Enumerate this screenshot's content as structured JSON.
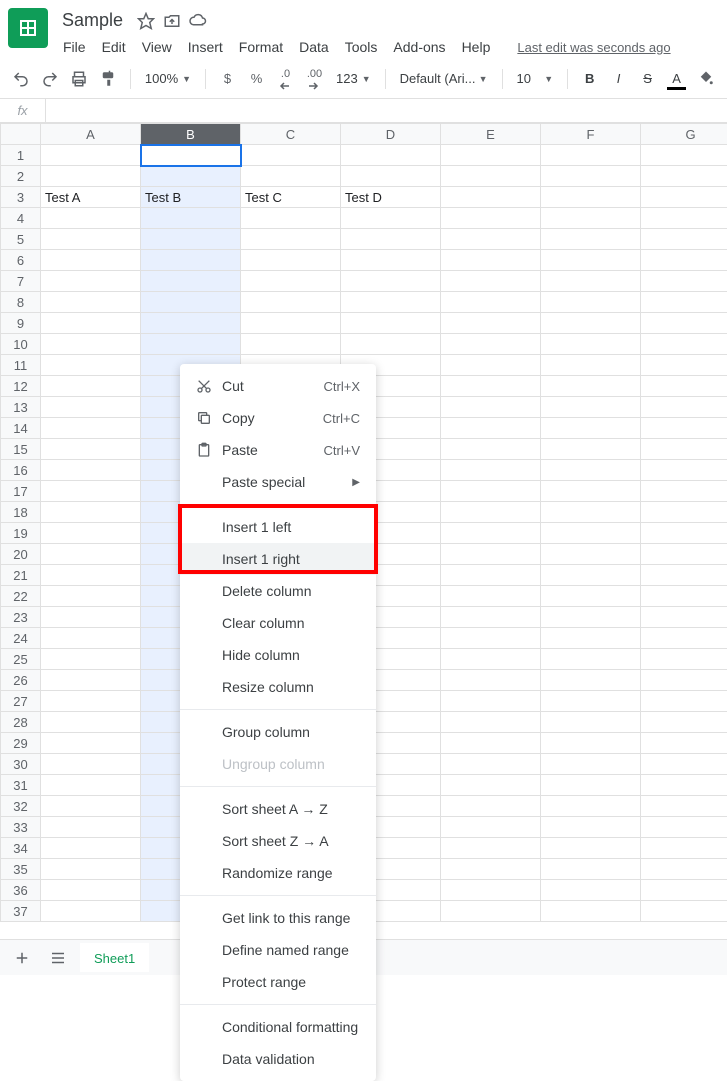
{
  "doc": {
    "title": "Sample",
    "last_edit": "Last edit was seconds ago"
  },
  "menubar": [
    "File",
    "Edit",
    "View",
    "Insert",
    "Format",
    "Data",
    "Tools",
    "Add-ons",
    "Help"
  ],
  "toolbar": {
    "zoom": "100%",
    "currency": "$",
    "percent": "%",
    "dec_dec": ".0",
    "dec_inc": ".00",
    "numfmt": "123",
    "font": "Default (Ari...",
    "font_size": "10",
    "bold": "B",
    "italic": "I",
    "strike": "S",
    "textcolor": "A"
  },
  "columns": [
    "A",
    "B",
    "C",
    "D",
    "E",
    "F",
    "G"
  ],
  "selected_column_index": 1,
  "row_count": 37,
  "cells": {
    "3": {
      "A": "Test A",
      "B": "Test B",
      "C": "Test C",
      "D": "Test D"
    }
  },
  "context_menu": {
    "cut": {
      "label": "Cut",
      "shortcut": "Ctrl+X"
    },
    "copy": {
      "label": "Copy",
      "shortcut": "Ctrl+C"
    },
    "paste": {
      "label": "Paste",
      "shortcut": "Ctrl+V"
    },
    "paste_special": {
      "label": "Paste special"
    },
    "insert_left": {
      "label": "Insert 1 left"
    },
    "insert_right": {
      "label": "Insert 1 right"
    },
    "delete_col": {
      "label": "Delete column"
    },
    "clear_col": {
      "label": "Clear column"
    },
    "hide_col": {
      "label": "Hide column"
    },
    "resize_col": {
      "label": "Resize column"
    },
    "group_col": {
      "label": "Group column"
    },
    "ungroup_col": {
      "label": "Ungroup column"
    },
    "sort_az": {
      "label": "Sort sheet A → Z"
    },
    "sort_za": {
      "label": "Sort sheet Z → A"
    },
    "randomize": {
      "label": "Randomize range"
    },
    "get_link": {
      "label": "Get link to this range"
    },
    "named_range": {
      "label": "Define named range"
    },
    "protect": {
      "label": "Protect range"
    },
    "cond_fmt": {
      "label": "Conditional formatting"
    },
    "data_val": {
      "label": "Data validation"
    }
  },
  "sheet_tab": "Sheet1"
}
